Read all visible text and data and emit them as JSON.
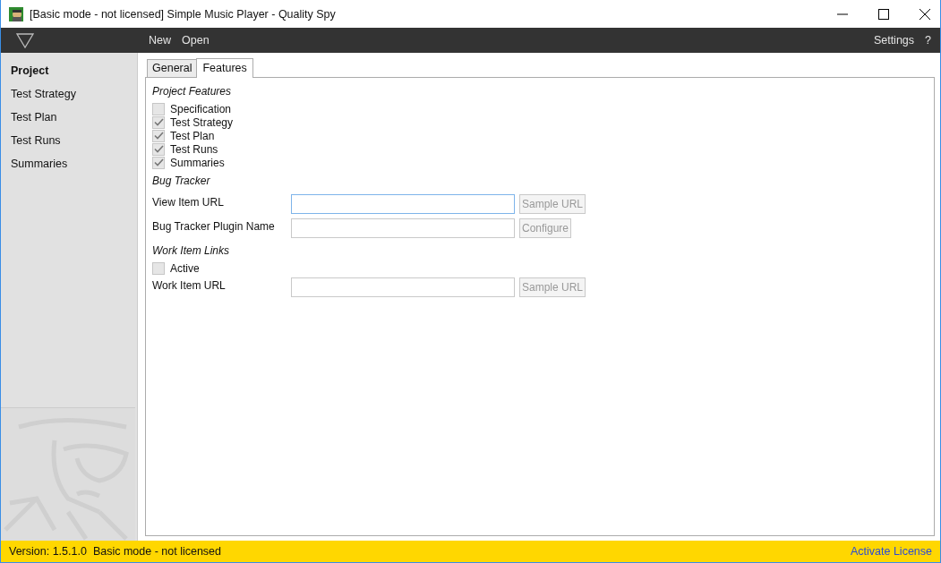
{
  "window": {
    "title": "[Basic mode - not licensed] Simple Music Player - Quality Spy"
  },
  "toolbar": {
    "items": [
      {
        "label": "New"
      },
      {
        "label": "Open"
      }
    ],
    "right_items": [
      {
        "label": "Settings"
      },
      {
        "label": "?"
      }
    ]
  },
  "sidebar": {
    "items": [
      {
        "label": "Project",
        "selected": true
      },
      {
        "label": "Test Strategy",
        "selected": false
      },
      {
        "label": "Test Plan",
        "selected": false
      },
      {
        "label": "Test Runs",
        "selected": false
      },
      {
        "label": "Summaries",
        "selected": false
      }
    ]
  },
  "tabs": [
    {
      "label": "General",
      "selected": false
    },
    {
      "label": "Features",
      "selected": true
    }
  ],
  "sections": [
    {
      "heading": "Project Features",
      "rows": [
        {
          "kind": "checkbox",
          "label": "Specification",
          "checked": false
        },
        {
          "kind": "checkbox",
          "label": "Test Strategy",
          "checked": true
        },
        {
          "kind": "checkbox",
          "label": "Test Plan",
          "checked": true
        },
        {
          "kind": "checkbox",
          "label": "Test Runs",
          "checked": true
        },
        {
          "kind": "checkbox",
          "label": "Summaries",
          "checked": true
        }
      ]
    },
    {
      "heading": "Bug Tracker",
      "rows": [
        {
          "kind": "field",
          "label": "View Item URL",
          "button": "Sample URL",
          "focused": true
        },
        {
          "kind": "field",
          "label": "Bug Tracker Plugin Name",
          "button": "Configure",
          "focused": false
        }
      ]
    },
    {
      "heading": "Work Item Links",
      "rows": [
        {
          "kind": "checkbox",
          "label": "Active",
          "checked": false
        },
        {
          "kind": "field",
          "label": "Work Item URL",
          "button": "Sample URL",
          "focused": false
        }
      ]
    }
  ],
  "status_bar": {
    "version": "Version: 1.5.1.0",
    "mode": "Basic mode - not licensed",
    "link": "Activate License"
  }
}
